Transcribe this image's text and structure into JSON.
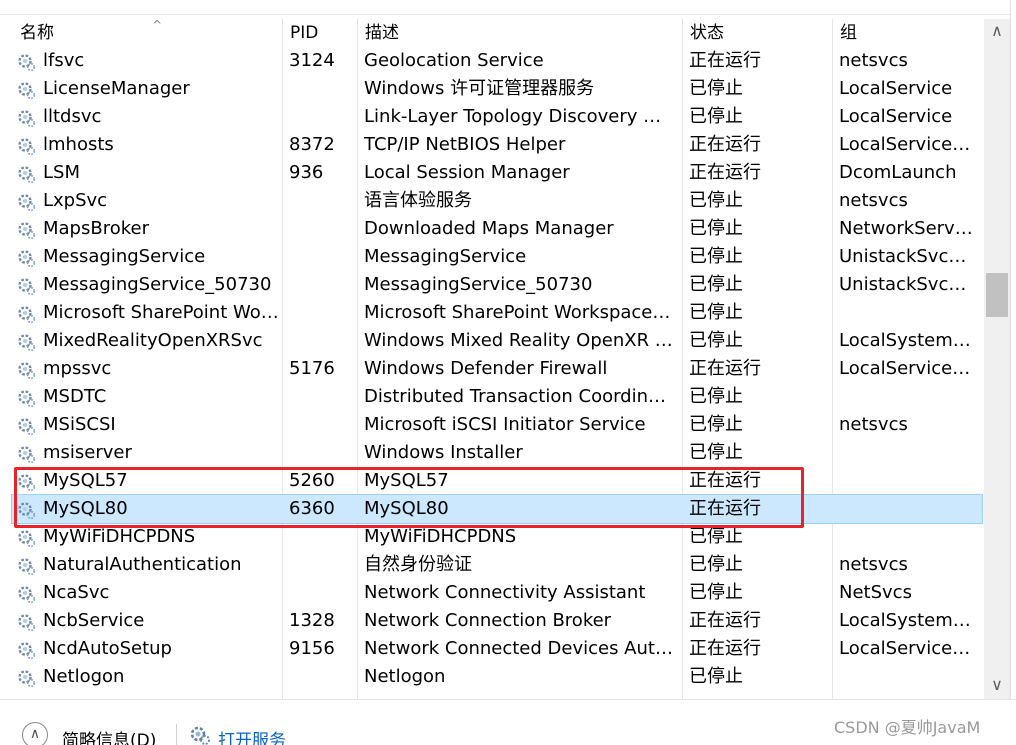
{
  "columns": {
    "name": "名称",
    "pid": "PID",
    "desc": "描述",
    "status": "状态",
    "group": "组"
  },
  "rows": [
    {
      "name": "lfsvc",
      "pid": "3124",
      "desc": "Geolocation Service",
      "status": "正在运行",
      "group": "netsvcs"
    },
    {
      "name": "LicenseManager",
      "pid": "",
      "desc": "Windows 许可证管理器服务",
      "status": "已停止",
      "group": "LocalService"
    },
    {
      "name": "lltdsvc",
      "pid": "",
      "desc": "Link-Layer Topology Discovery Ma...",
      "status": "已停止",
      "group": "LocalService"
    },
    {
      "name": "lmhosts",
      "pid": "8372",
      "desc": "TCP/IP NetBIOS Helper",
      "status": "正在运行",
      "group": "LocalServiceN..."
    },
    {
      "name": "LSM",
      "pid": "936",
      "desc": "Local Session Manager",
      "status": "正在运行",
      "group": "DcomLaunch"
    },
    {
      "name": "LxpSvc",
      "pid": "",
      "desc": "语言体验服务",
      "status": "已停止",
      "group": "netsvcs"
    },
    {
      "name": "MapsBroker",
      "pid": "",
      "desc": "Downloaded Maps Manager",
      "status": "已停止",
      "group": "NetworkService"
    },
    {
      "name": "MessagingService",
      "pid": "",
      "desc": "MessagingService",
      "status": "已停止",
      "group": "UnistackSvcGr..."
    },
    {
      "name": "MessagingService_50730",
      "pid": "",
      "desc": "MessagingService_50730",
      "status": "已停止",
      "group": "UnistackSvcGr..."
    },
    {
      "name": "Microsoft SharePoint Wor...",
      "pid": "",
      "desc": "Microsoft SharePoint Workspace A...",
      "status": "已停止",
      "group": ""
    },
    {
      "name": "MixedRealityOpenXRSvc",
      "pid": "",
      "desc": "Windows Mixed Reality OpenXR S...",
      "status": "已停止",
      "group": "LocalSystemN..."
    },
    {
      "name": "mpssvc",
      "pid": "5176",
      "desc": "Windows Defender Firewall",
      "status": "正在运行",
      "group": "LocalServiceN..."
    },
    {
      "name": "MSDTC",
      "pid": "",
      "desc": "Distributed Transaction Coordinator",
      "status": "已停止",
      "group": ""
    },
    {
      "name": "MSiSCSI",
      "pid": "",
      "desc": "Microsoft iSCSI Initiator Service",
      "status": "已停止",
      "group": "netsvcs"
    },
    {
      "name": "msiserver",
      "pid": "",
      "desc": "Windows Installer",
      "status": "已停止",
      "group": ""
    },
    {
      "name": "MySQL57",
      "pid": "5260",
      "desc": "MySQL57",
      "status": "正在运行",
      "group": ""
    },
    {
      "name": "MySQL80",
      "pid": "6360",
      "desc": "MySQL80",
      "status": "正在运行",
      "group": "",
      "selected": true
    },
    {
      "name": "MyWiFiDHCPDNS",
      "pid": "",
      "desc": "MyWiFiDHCPDNS",
      "status": "已停止",
      "group": ""
    },
    {
      "name": "NaturalAuthentication",
      "pid": "",
      "desc": "自然身份验证",
      "status": "已停止",
      "group": "netsvcs"
    },
    {
      "name": "NcaSvc",
      "pid": "",
      "desc": "Network Connectivity Assistant",
      "status": "已停止",
      "group": "NetSvcs"
    },
    {
      "name": "NcbService",
      "pid": "1328",
      "desc": "Network Connection Broker",
      "status": "正在运行",
      "group": "LocalSystemN..."
    },
    {
      "name": "NcdAutoSetup",
      "pid": "9156",
      "desc": "Network Connected Devices Auto-...",
      "status": "正在运行",
      "group": "LocalServiceN..."
    },
    {
      "name": "Netlogon",
      "pid": "",
      "desc": "Netlogon",
      "status": "已停止",
      "group": ""
    }
  ],
  "footer": {
    "brief_label": "简略信息(D)",
    "open_services_label": "打开服务"
  },
  "watermark": "CSDN @夏帅JavaM",
  "colors": {
    "highlight_box": "#e8232a",
    "selection": "#cce8ff",
    "link": "#0a64c8"
  }
}
